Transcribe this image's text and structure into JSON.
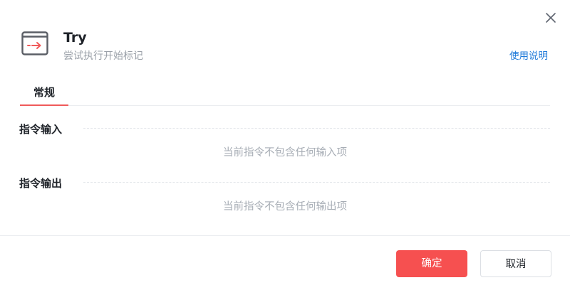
{
  "dialog": {
    "close_icon": "close-icon",
    "command_icon": "try-command-icon",
    "title": "Try",
    "subtitle": "尝试执行开始标记",
    "help_link": "使用说明"
  },
  "tabs": [
    {
      "label": "常规",
      "active": true
    }
  ],
  "sections": {
    "input": {
      "title": "指令输入",
      "empty_text": "当前指令不包含任何输入项"
    },
    "output": {
      "title": "指令输出",
      "empty_text": "当前指令不包含任何输出项"
    }
  },
  "footer": {
    "confirm_label": "确定",
    "cancel_label": "取消"
  },
  "colors": {
    "accent": "#f65050",
    "link": "#1f7ad9",
    "muted_text": "#9aa0a8"
  }
}
